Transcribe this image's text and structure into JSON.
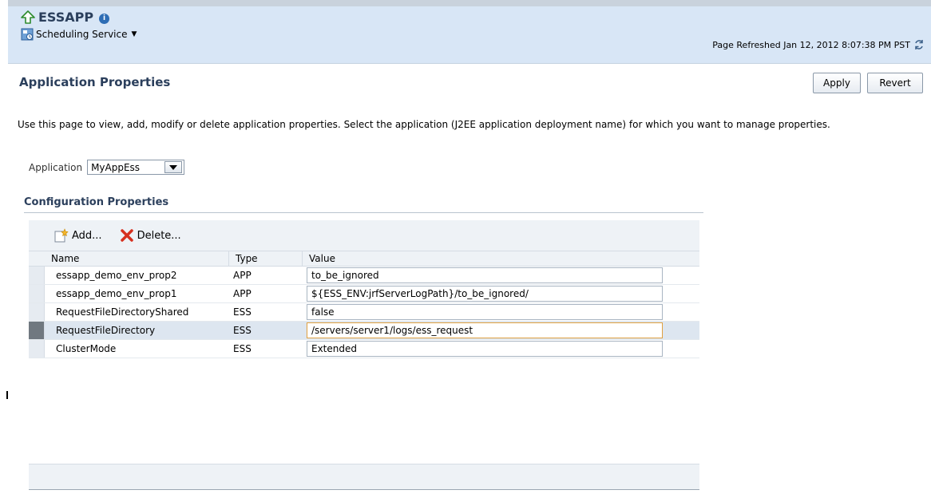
{
  "header": {
    "app_name": "ESSAPP",
    "target_menu_label": "Scheduling Service",
    "refreshed_text": "Page Refreshed Jan 12, 2012 8:07:38 PM PST"
  },
  "page": {
    "title": "Application Properties",
    "apply_label": "Apply",
    "revert_label": "Revert",
    "description": "Use this page to view, add, modify or delete application properties. Select the application (J2EE application deployment name) for which you want to manage properties.",
    "application_label": "Application",
    "application_value": "MyAppEss"
  },
  "config": {
    "section_title": "Configuration Properties",
    "add_label": "Add...",
    "delete_label": "Delete...",
    "columns": {
      "name": "Name",
      "type": "Type",
      "value": "Value"
    },
    "rows": [
      {
        "name": "essapp_demo_env_prop2",
        "type": "APP",
        "value": "to_be_ignored"
      },
      {
        "name": "essapp_demo_env_prop1",
        "type": "APP",
        "value": "${ESS_ENV:jrfServerLogPath}/to_be_ignored/"
      },
      {
        "name": "RequestFileDirectoryShared",
        "type": "ESS",
        "value": "false"
      },
      {
        "name": "RequestFileDirectory",
        "type": "ESS",
        "value": "/servers/server1/logs/ess_request"
      },
      {
        "name": "ClusterMode",
        "type": "ESS",
        "value": "Extended"
      }
    ],
    "selected_row": "RequestFileDirectory"
  },
  "icons": {
    "app_icon": "green-up-arrow-icon",
    "info": "info-icon",
    "target_menu": "scheduling-service-icon",
    "menu_caret": "chevron-down-icon",
    "refresh": "refresh-icon",
    "dropdown": "dropdown-arrow-icon",
    "add": "add-icon",
    "delete": "red-x-delete-icon"
  },
  "colors": {
    "header_bg": "#d8e6f6",
    "title_color": "#2b3f5c",
    "selected_row_bg": "#dde6f0",
    "selected_input_border": "#e0a040"
  }
}
